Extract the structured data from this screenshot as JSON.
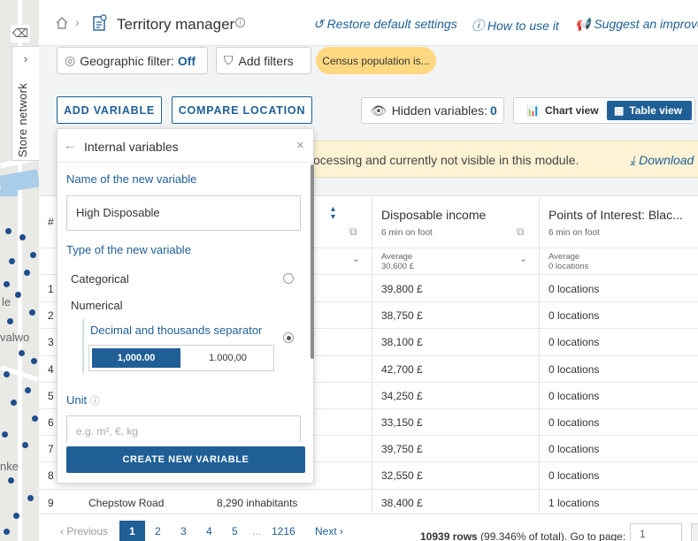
{
  "map": {
    "labels": [
      "le",
      "valwo",
      "nke"
    ]
  },
  "store_tab": {
    "label": "Store network"
  },
  "header": {
    "title": "Territory manager",
    "links": [
      "Restore default settings",
      "How to use it",
      "Suggest an improvem"
    ]
  },
  "filters": {
    "geo_label": "Geographic filter:",
    "geo_value": "Off",
    "add_filters": "Add filters",
    "census_chip": "Census population is..."
  },
  "actions": {
    "add_variable": "ADD VARIABLE",
    "compare_location": "COMPARE LOCATION",
    "hidden_label": "Hidden variables:",
    "hidden_count": "0",
    "chart_view": "Chart view",
    "table_view": "Table view"
  },
  "notice": {
    "text": "ocessing and currently not visible in this module.",
    "download": "Download"
  },
  "table": {
    "hash": "#",
    "columns": [
      {
        "title": "Disposable income",
        "sub": "6 min on foot",
        "agg_label": "Average",
        "agg_value": "30,600 £"
      },
      {
        "title": "Points of Interest: Blac...",
        "sub": "6 min on foot",
        "agg_label": "Average",
        "agg_value": "0 locations"
      }
    ],
    "rows": [
      {
        "n": "1",
        "name": "",
        "pop": "",
        "income": "39,800 £",
        "poi": "0 locations"
      },
      {
        "n": "2",
        "name": "",
        "pop": "",
        "income": "38,750 £",
        "poi": "0 locations"
      },
      {
        "n": "3",
        "name": "",
        "pop": "",
        "income": "38,100 £",
        "poi": "0 locations"
      },
      {
        "n": "4",
        "name": "",
        "pop": "",
        "income": "42,700 £",
        "poi": "0 locations"
      },
      {
        "n": "5",
        "name": "",
        "pop": "",
        "income": "34,250 £",
        "poi": "0 locations"
      },
      {
        "n": "6",
        "name": "",
        "pop": "",
        "income": "33,150 £",
        "poi": "0 locations"
      },
      {
        "n": "7",
        "name": "",
        "pop": "",
        "income": "39,750 £",
        "poi": "0 locations"
      },
      {
        "n": "8",
        "name": "",
        "pop": "",
        "income": "32,550 £",
        "poi": "0 locations"
      },
      {
        "n": "9",
        "name": "Chepstow Road",
        "pop": "8,290 inhabitants",
        "income": "38,400 £",
        "poi": "1 locations"
      }
    ]
  },
  "pager": {
    "previous": "Previous",
    "pages": [
      "1",
      "2",
      "3",
      "4",
      "5",
      "...",
      "1216"
    ],
    "next": "Next",
    "rows_count": "10939 rows",
    "rows_pct": "(99.346% of total).",
    "goto_label": "Go to page:",
    "goto_value": "1"
  },
  "panel": {
    "title": "Internal variables",
    "name_label": "Name of the new variable",
    "name_value": "High Disposable",
    "type_label": "Type of the new variable",
    "categorical": "Categorical",
    "numerical": "Numerical",
    "separator_label": "Decimal and thousands separator",
    "sep_option_1": "1,000.00",
    "sep_option_2": "1.000,00",
    "unit_label": "Unit",
    "unit_placeholder": "e.g. m², €, kg",
    "create_button": "CREATE NEW VARIABLE"
  },
  "colors": {
    "accent": "#1f5f96",
    "chip_yellow": "#ffd982",
    "notice_bg": "#fdf3d4"
  }
}
